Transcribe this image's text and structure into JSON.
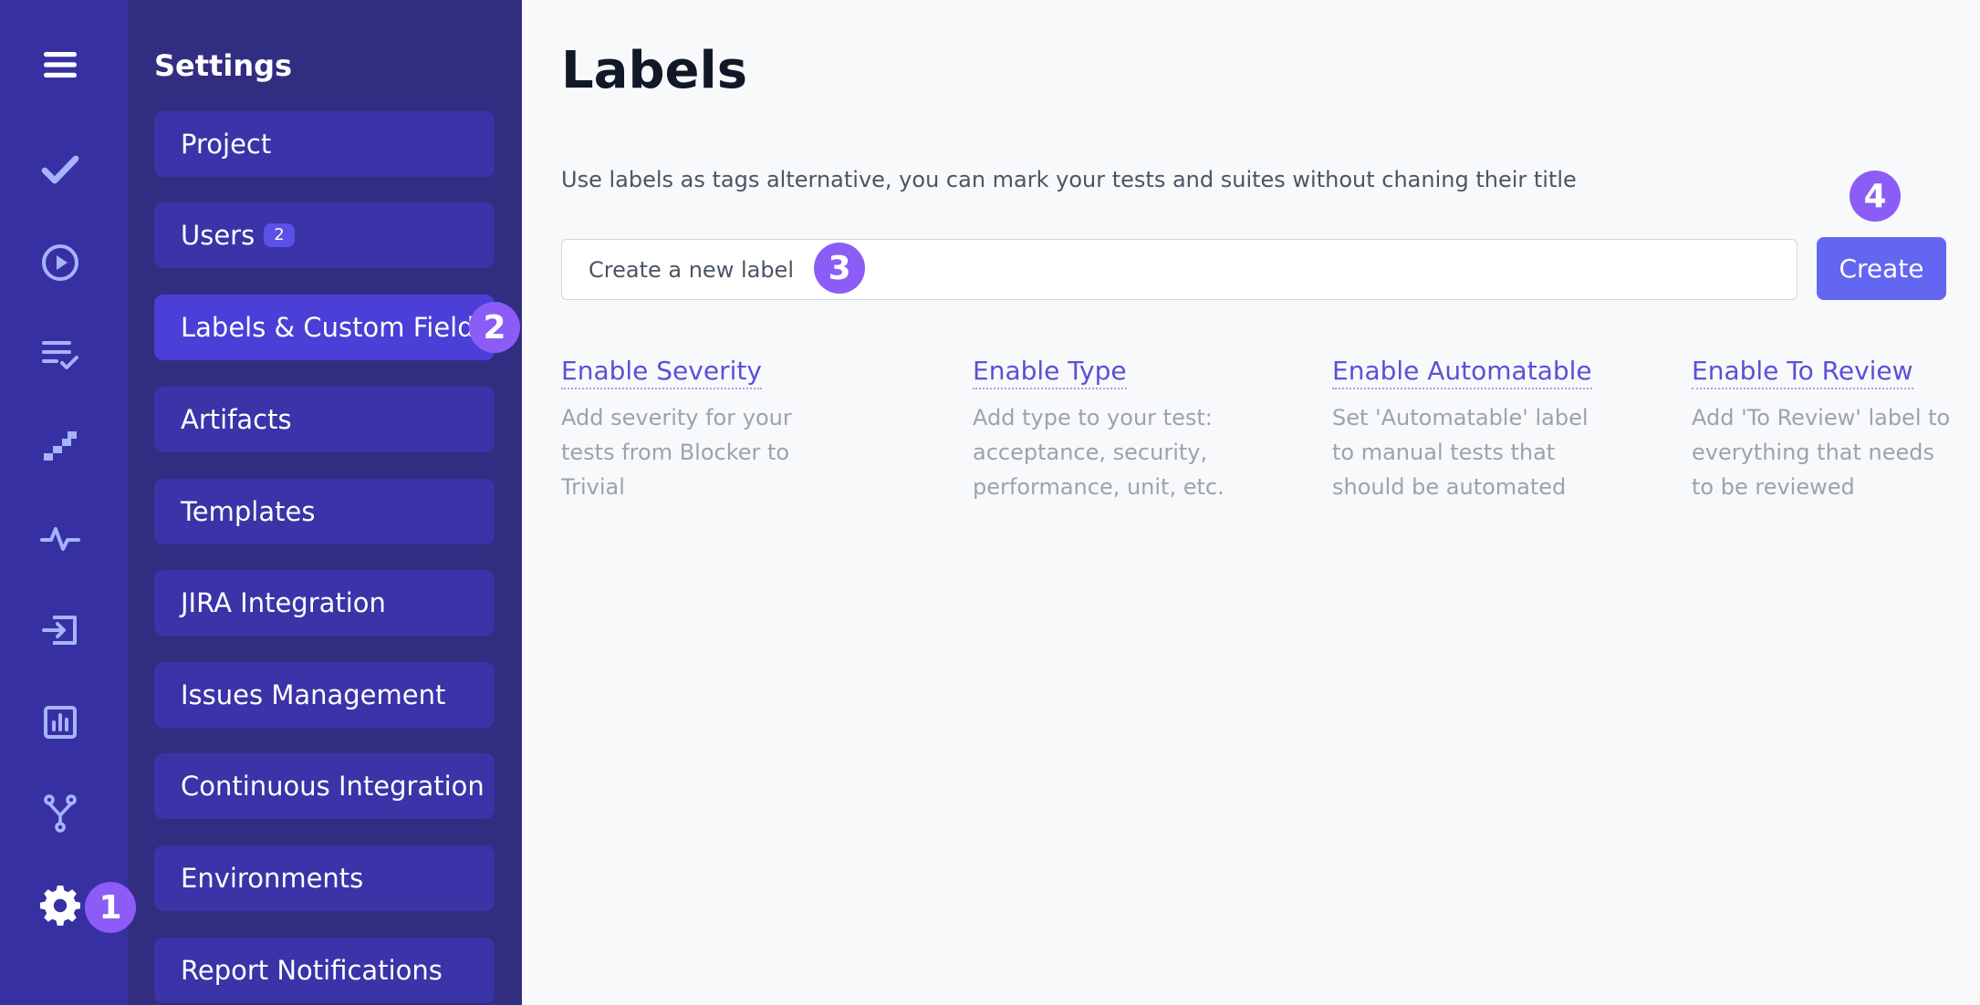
{
  "rail": {
    "icons": [
      "menu-icon",
      "check-icon",
      "play-icon",
      "checklist-icon",
      "steps-icon",
      "pulse-icon",
      "import-icon",
      "chart-icon",
      "branch-icon",
      "gear-icon"
    ]
  },
  "settings": {
    "title": "Settings",
    "items": [
      {
        "label": "Project"
      },
      {
        "label": "Users",
        "badge": "2"
      },
      {
        "label": "Labels & Custom Fields",
        "active": true
      },
      {
        "label": "Artifacts"
      },
      {
        "label": "Templates"
      },
      {
        "label": "JIRA Integration"
      },
      {
        "label": "Issues Management"
      },
      {
        "label": "Continuous Integration"
      },
      {
        "label": "Environments"
      },
      {
        "label": "Report Notifications"
      }
    ]
  },
  "main": {
    "title": "Labels",
    "description": "Use labels as tags alternative, you can mark your tests and suites without chaning their title",
    "input_placeholder": "Create a new label",
    "create_label": "Create",
    "features": [
      {
        "link": "Enable Severity",
        "lines": [
          "Add severity for your",
          "tests from Blocker to",
          "Trivial"
        ]
      },
      {
        "link": "Enable Type",
        "lines": [
          "Add type to your test:",
          "acceptance, security,",
          "performance, unit, etc."
        ]
      },
      {
        "link": "Enable Automatable",
        "lines": [
          "Set 'Automatable' label",
          "to manual tests that",
          "should be automated"
        ]
      },
      {
        "link": "Enable To Review",
        "lines": [
          "Add 'To Review' label to",
          "everything that needs",
          "to be reviewed"
        ]
      }
    ]
  },
  "steps": [
    "1",
    "2",
    "3",
    "4"
  ],
  "colors": {
    "rail_bg": "#3730a3",
    "settings_bg": "#312e81",
    "nav_item_bg": "#3b33a8",
    "nav_item_active_bg": "#4a3fd6",
    "accent": "#6366f1",
    "link": "#5b50d6",
    "step_marker": "#8b5cf6",
    "rail_icon": "#a5b4fc"
  }
}
